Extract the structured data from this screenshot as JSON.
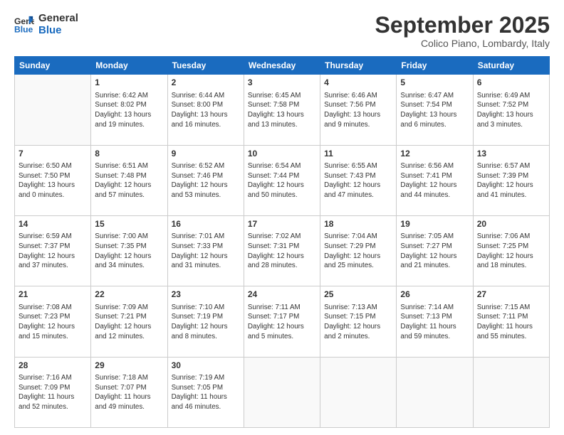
{
  "header": {
    "logo_line1": "General",
    "logo_line2": "Blue",
    "month": "September 2025",
    "location": "Colico Piano, Lombardy, Italy"
  },
  "days_of_week": [
    "Sunday",
    "Monday",
    "Tuesday",
    "Wednesday",
    "Thursday",
    "Friday",
    "Saturday"
  ],
  "weeks": [
    [
      {
        "day": "",
        "info": ""
      },
      {
        "day": "1",
        "info": "Sunrise: 6:42 AM\nSunset: 8:02 PM\nDaylight: 13 hours\nand 19 minutes."
      },
      {
        "day": "2",
        "info": "Sunrise: 6:44 AM\nSunset: 8:00 PM\nDaylight: 13 hours\nand 16 minutes."
      },
      {
        "day": "3",
        "info": "Sunrise: 6:45 AM\nSunset: 7:58 PM\nDaylight: 13 hours\nand 13 minutes."
      },
      {
        "day": "4",
        "info": "Sunrise: 6:46 AM\nSunset: 7:56 PM\nDaylight: 13 hours\nand 9 minutes."
      },
      {
        "day": "5",
        "info": "Sunrise: 6:47 AM\nSunset: 7:54 PM\nDaylight: 13 hours\nand 6 minutes."
      },
      {
        "day": "6",
        "info": "Sunrise: 6:49 AM\nSunset: 7:52 PM\nDaylight: 13 hours\nand 3 minutes."
      }
    ],
    [
      {
        "day": "7",
        "info": "Sunrise: 6:50 AM\nSunset: 7:50 PM\nDaylight: 13 hours\nand 0 minutes."
      },
      {
        "day": "8",
        "info": "Sunrise: 6:51 AM\nSunset: 7:48 PM\nDaylight: 12 hours\nand 57 minutes."
      },
      {
        "day": "9",
        "info": "Sunrise: 6:52 AM\nSunset: 7:46 PM\nDaylight: 12 hours\nand 53 minutes."
      },
      {
        "day": "10",
        "info": "Sunrise: 6:54 AM\nSunset: 7:44 PM\nDaylight: 12 hours\nand 50 minutes."
      },
      {
        "day": "11",
        "info": "Sunrise: 6:55 AM\nSunset: 7:43 PM\nDaylight: 12 hours\nand 47 minutes."
      },
      {
        "day": "12",
        "info": "Sunrise: 6:56 AM\nSunset: 7:41 PM\nDaylight: 12 hours\nand 44 minutes."
      },
      {
        "day": "13",
        "info": "Sunrise: 6:57 AM\nSunset: 7:39 PM\nDaylight: 12 hours\nand 41 minutes."
      }
    ],
    [
      {
        "day": "14",
        "info": "Sunrise: 6:59 AM\nSunset: 7:37 PM\nDaylight: 12 hours\nand 37 minutes."
      },
      {
        "day": "15",
        "info": "Sunrise: 7:00 AM\nSunset: 7:35 PM\nDaylight: 12 hours\nand 34 minutes."
      },
      {
        "day": "16",
        "info": "Sunrise: 7:01 AM\nSunset: 7:33 PM\nDaylight: 12 hours\nand 31 minutes."
      },
      {
        "day": "17",
        "info": "Sunrise: 7:02 AM\nSunset: 7:31 PM\nDaylight: 12 hours\nand 28 minutes."
      },
      {
        "day": "18",
        "info": "Sunrise: 7:04 AM\nSunset: 7:29 PM\nDaylight: 12 hours\nand 25 minutes."
      },
      {
        "day": "19",
        "info": "Sunrise: 7:05 AM\nSunset: 7:27 PM\nDaylight: 12 hours\nand 21 minutes."
      },
      {
        "day": "20",
        "info": "Sunrise: 7:06 AM\nSunset: 7:25 PM\nDaylight: 12 hours\nand 18 minutes."
      }
    ],
    [
      {
        "day": "21",
        "info": "Sunrise: 7:08 AM\nSunset: 7:23 PM\nDaylight: 12 hours\nand 15 minutes."
      },
      {
        "day": "22",
        "info": "Sunrise: 7:09 AM\nSunset: 7:21 PM\nDaylight: 12 hours\nand 12 minutes."
      },
      {
        "day": "23",
        "info": "Sunrise: 7:10 AM\nSunset: 7:19 PM\nDaylight: 12 hours\nand 8 minutes."
      },
      {
        "day": "24",
        "info": "Sunrise: 7:11 AM\nSunset: 7:17 PM\nDaylight: 12 hours\nand 5 minutes."
      },
      {
        "day": "25",
        "info": "Sunrise: 7:13 AM\nSunset: 7:15 PM\nDaylight: 12 hours\nand 2 minutes."
      },
      {
        "day": "26",
        "info": "Sunrise: 7:14 AM\nSunset: 7:13 PM\nDaylight: 11 hours\nand 59 minutes."
      },
      {
        "day": "27",
        "info": "Sunrise: 7:15 AM\nSunset: 7:11 PM\nDaylight: 11 hours\nand 55 minutes."
      }
    ],
    [
      {
        "day": "28",
        "info": "Sunrise: 7:16 AM\nSunset: 7:09 PM\nDaylight: 11 hours\nand 52 minutes."
      },
      {
        "day": "29",
        "info": "Sunrise: 7:18 AM\nSunset: 7:07 PM\nDaylight: 11 hours\nand 49 minutes."
      },
      {
        "day": "30",
        "info": "Sunrise: 7:19 AM\nSunset: 7:05 PM\nDaylight: 11 hours\nand 46 minutes."
      },
      {
        "day": "",
        "info": ""
      },
      {
        "day": "",
        "info": ""
      },
      {
        "day": "",
        "info": ""
      },
      {
        "day": "",
        "info": ""
      }
    ]
  ]
}
